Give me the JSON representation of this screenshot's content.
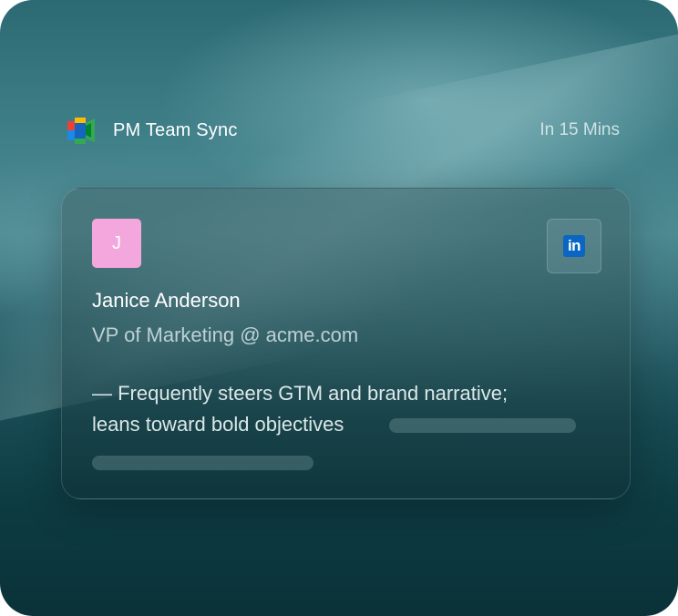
{
  "meeting": {
    "title": "PM Team Sync",
    "time": "In 15 Mins",
    "app_icon": "google-meet-icon"
  },
  "person": {
    "avatar_initial": "J",
    "avatar_color": "#f3a7dc",
    "name": "Janice Anderson",
    "role": "VP of Marketing @ acme.com",
    "note_line1": "— Frequently steers GTM and brand narrative;",
    "note_line2": "leans toward bold objectives"
  },
  "linkedin": {
    "icon": "linkedin-icon",
    "label": "in",
    "color": "#0a66c2"
  }
}
